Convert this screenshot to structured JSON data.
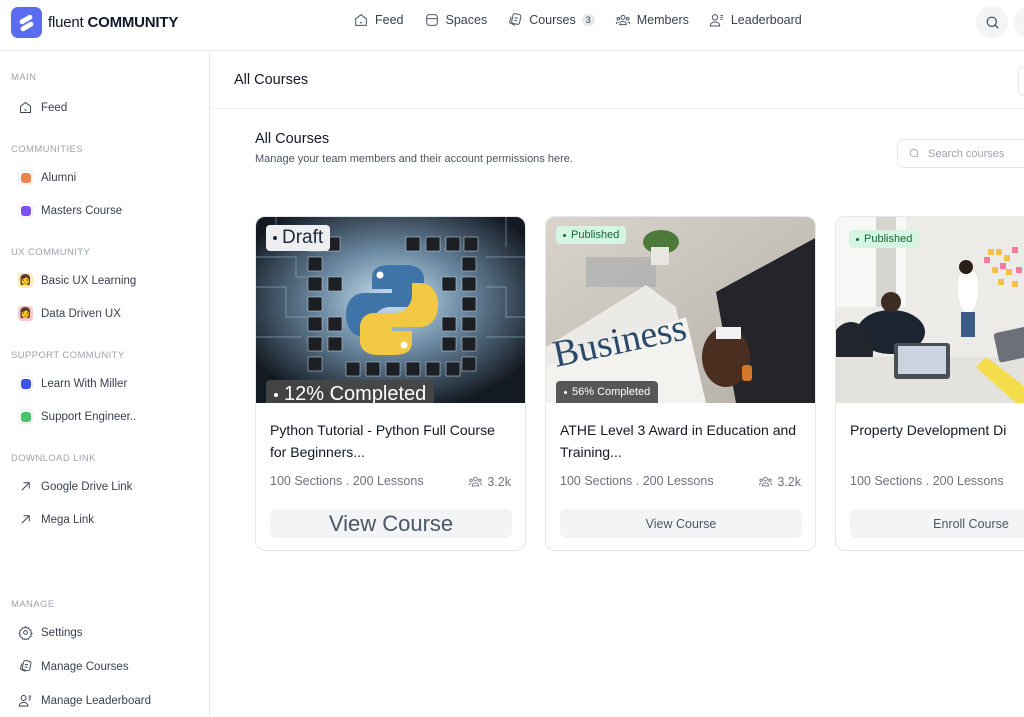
{
  "app": {
    "logo_light": "fluent",
    "logo_bold": "COMMUNITY",
    "brand_color": "#5b6cf0"
  },
  "topnav": {
    "items": [
      {
        "label": "Feed",
        "icon": "home-icon"
      },
      {
        "label": "Spaces",
        "icon": "spaces-icon"
      },
      {
        "label": "Courses",
        "icon": "courses-icon",
        "badge": "3"
      },
      {
        "label": "Members",
        "icon": "members-icon"
      },
      {
        "label": "Leaderboard",
        "icon": "leaderboard-icon"
      }
    ]
  },
  "sidebar": {
    "sections": [
      {
        "title": "MAIN",
        "items": [
          {
            "label": "Feed",
            "icon": "home-icon"
          }
        ]
      },
      {
        "title": "COMMUNITIES",
        "items": [
          {
            "label": "Alumni",
            "color": "#f0844f"
          },
          {
            "label": "Masters Course",
            "color": "#7b4ff0"
          }
        ]
      },
      {
        "title": "UX COMMUNITY",
        "items": [
          {
            "label": "Basic UX Learning",
            "icon": "avatar-icon",
            "bg": "#fde9b8"
          },
          {
            "label": "Data Driven UX",
            "icon": "avatar-icon",
            "bg": "#f9c7c7"
          }
        ]
      },
      {
        "title": "SUPPORT COMMUNITY",
        "items": [
          {
            "label": "Learn With Miller",
            "color": "#3b54f0"
          },
          {
            "label": "Support Engineer..",
            "color": "#4cc26a"
          }
        ]
      },
      {
        "title": "DOWNLOAD LINK",
        "items": [
          {
            "label": "Google Drive Link",
            "icon": "arrow-up-right-icon"
          },
          {
            "label": "Mega Link",
            "icon": "arrow-up-right-icon"
          }
        ]
      },
      {
        "title": "MANAGE",
        "items": [
          {
            "label": "Settings",
            "icon": "gear-icon"
          },
          {
            "label": "Manage Courses",
            "icon": "courses-icon"
          },
          {
            "label": "Manage Leaderboard",
            "icon": "leaderboard-icon"
          }
        ]
      }
    ]
  },
  "main": {
    "header_title": "All Courses",
    "content_title": "All Courses",
    "content_subtitle": "Manage your team members and their account permissions here.",
    "search_placeholder": "Search courses"
  },
  "courses": [
    {
      "status": "Draft",
      "progress_label": "12% Completed",
      "progress": 12,
      "title": "Python Tutorial - Python Full Course for Beginners...",
      "meta": "100 Sections . 200 Lessons",
      "members": "3.2k",
      "action": "View Course"
    },
    {
      "status": "Published",
      "progress_label": "56% Completed",
      "progress": 56,
      "title": "ATHE Level 3 Award in Education and Training...",
      "meta": "100 Sections . 200 Lessons",
      "members": "3.2k",
      "action": "View Course"
    },
    {
      "status": "Published",
      "title": "Property Development Di",
      "meta": "100 Sections . 200 Lessons",
      "action": "Enroll Course"
    }
  ]
}
